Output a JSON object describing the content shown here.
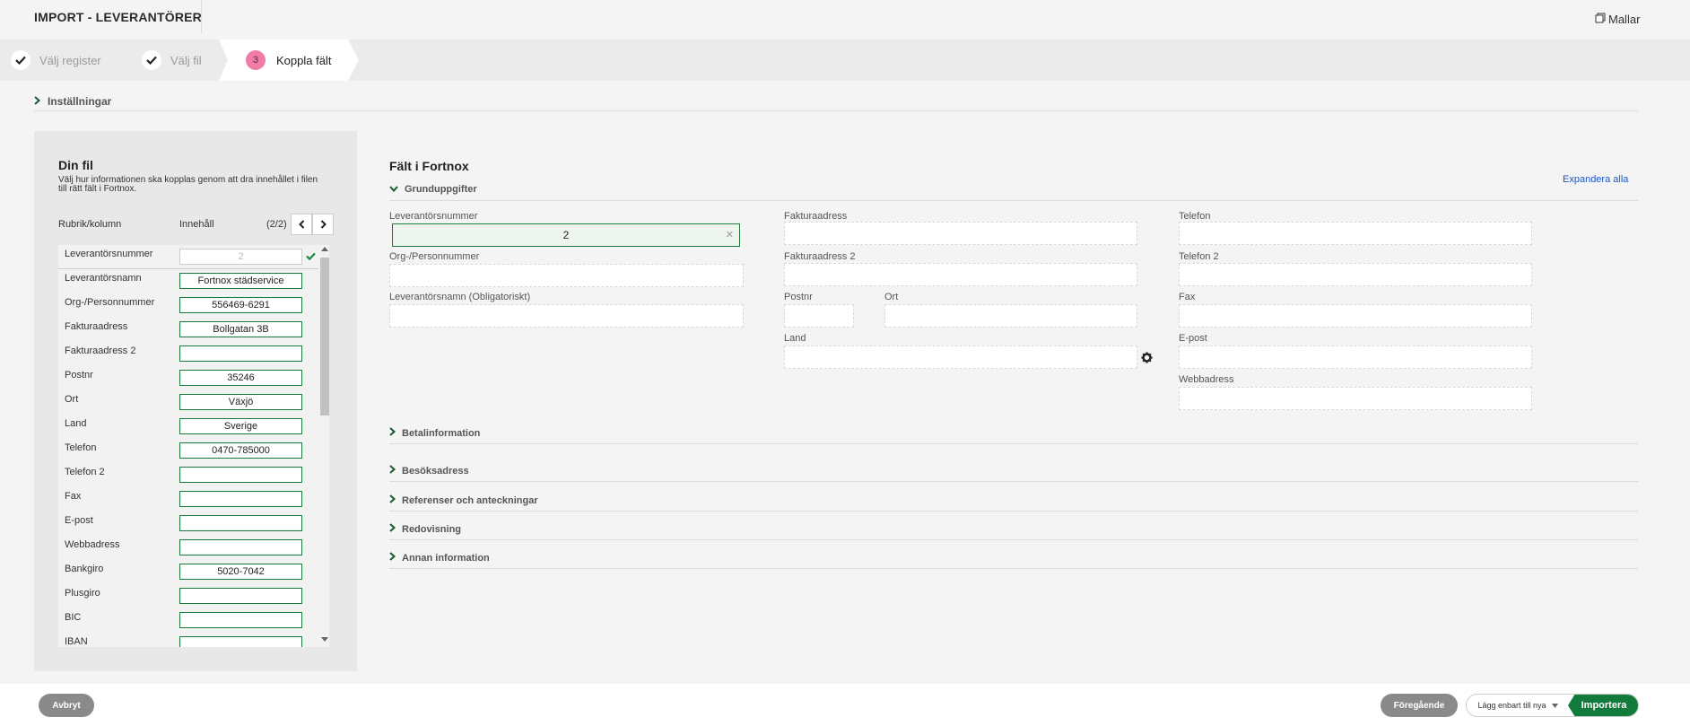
{
  "header": {
    "title": "IMPORT - LEVERANTÖRER",
    "templates_label": "Mallar"
  },
  "steps": [
    {
      "label": "Välj register",
      "state": "done"
    },
    {
      "label": "Välj fil",
      "state": "done"
    },
    {
      "number": "3",
      "label": "Koppla fält",
      "state": "active"
    }
  ],
  "settings": {
    "label": "Inställningar"
  },
  "file_panel": {
    "title": "Din fil",
    "description": "Välj hur informationen ska kopplas genom att dra innehållet i filen till rätt fält i Fortnox.",
    "col_header": "Rubrik/kolumn",
    "content_header": "Innehåll",
    "pager": "(2/2)",
    "rows": [
      {
        "label": "Leverantörsnummer",
        "value": "2",
        "used": true
      },
      {
        "label": "Leverantörsnamn",
        "value": "Fortnox städservice"
      },
      {
        "label": "Org-/Personnummer",
        "value": "556469-6291"
      },
      {
        "label": "Fakturaadress",
        "value": "Bollgatan 3B"
      },
      {
        "label": "Fakturaadress 2",
        "value": ""
      },
      {
        "label": "Postnr",
        "value": "35246"
      },
      {
        "label": "Ort",
        "value": "Växjö"
      },
      {
        "label": "Land",
        "value": "Sverige"
      },
      {
        "label": "Telefon",
        "value": "0470-785000"
      },
      {
        "label": "Telefon 2",
        "value": ""
      },
      {
        "label": "Fax",
        "value": ""
      },
      {
        "label": "E-post",
        "value": ""
      },
      {
        "label": "Webbadress",
        "value": ""
      },
      {
        "label": "Bankgiro",
        "value": "5020-7042"
      },
      {
        "label": "Plusgiro",
        "value": ""
      },
      {
        "label": "BIC",
        "value": ""
      },
      {
        "label": "IBAN",
        "value": ""
      }
    ]
  },
  "fortnox_panel": {
    "title": "Fält i Fortnox",
    "expand_all": "Expandera alla",
    "sections": {
      "grund": "Grunduppgifter",
      "betal": "Betalinformation",
      "besok": "Besöksadress",
      "ref": "Referenser och anteckningar",
      "redov": "Redovisning",
      "annan": "Annan information"
    },
    "fields": {
      "supplier_number": {
        "label": "Leverantörsnummer",
        "value": "2"
      },
      "org_number": {
        "label": "Org-/Personnummer"
      },
      "supplier_name": {
        "label": "Leverantörsnamn (Obligatoriskt)"
      },
      "invoice_address": {
        "label": "Fakturaadress"
      },
      "invoice_address2": {
        "label": "Fakturaadress 2"
      },
      "postal_code": {
        "label": "Postnr"
      },
      "city": {
        "label": "Ort"
      },
      "country": {
        "label": "Land"
      },
      "phone": {
        "label": "Telefon"
      },
      "phone2": {
        "label": "Telefon 2"
      },
      "fax": {
        "label": "Fax"
      },
      "email": {
        "label": "E-post"
      },
      "website": {
        "label": "Webbadress"
      }
    }
  },
  "footer": {
    "cancel": "Avbryt",
    "previous": "Föregående",
    "import_option": "Lägg enbart till nya",
    "import": "Importera"
  },
  "colors": {
    "accent_green": "#127a3a",
    "step_pink": "#f07ca8",
    "link_blue": "#1a56c8"
  }
}
